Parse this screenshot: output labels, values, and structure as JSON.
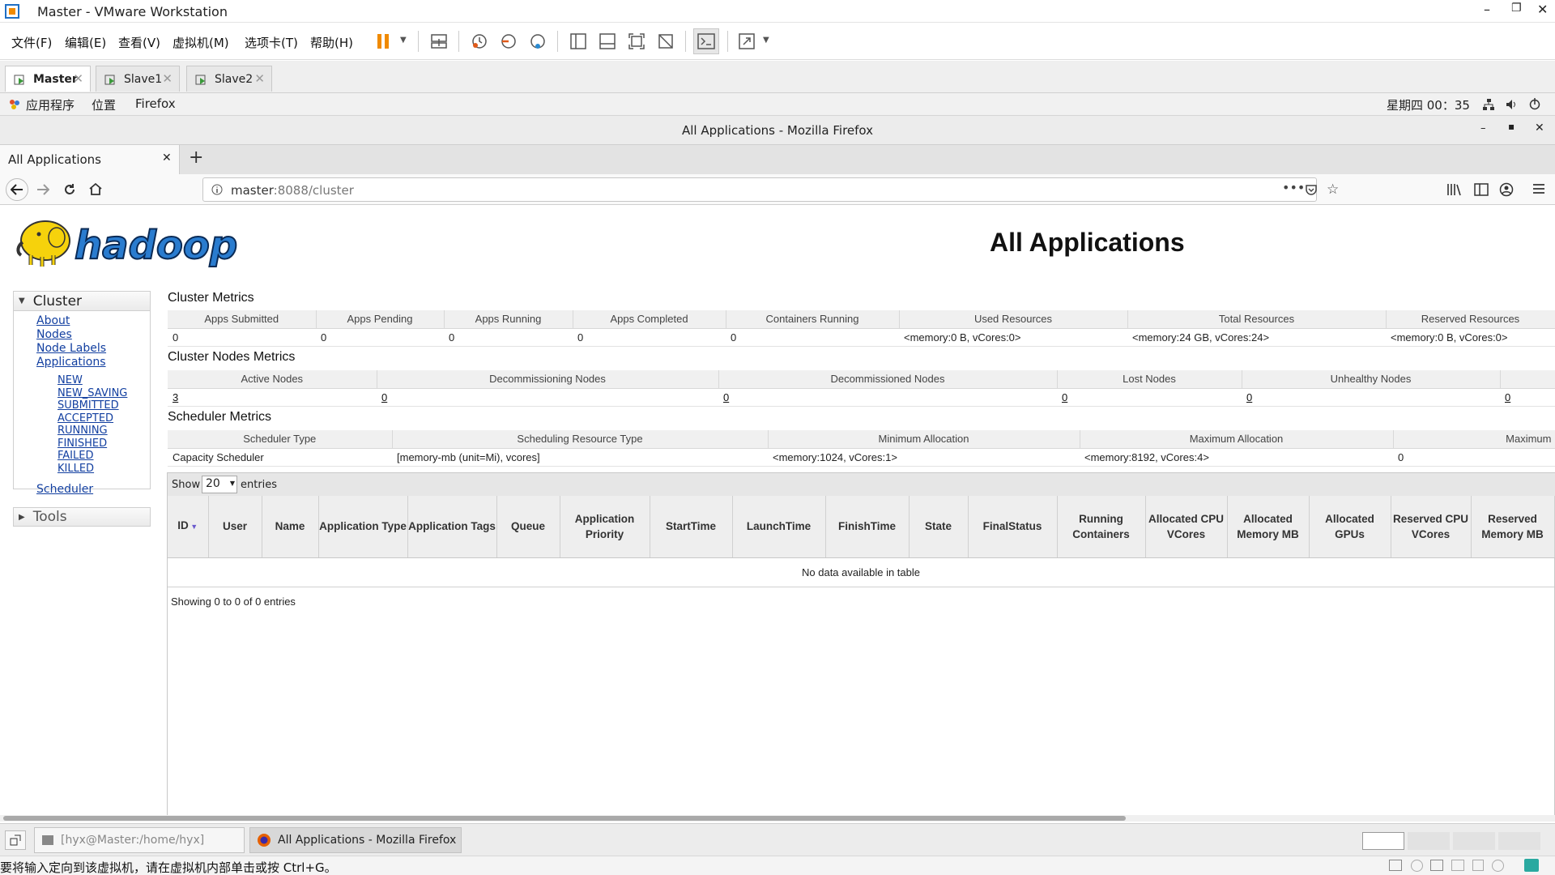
{
  "vmware": {
    "window_title": "Master - VMware Workstation",
    "menu": [
      "文件(F)",
      "编辑(E)",
      "查看(V)",
      "虚拟机(M)",
      "选项卡(T)",
      "帮助(H)"
    ],
    "tabs": [
      {
        "label": "Master",
        "active": true
      },
      {
        "label": "Slave1",
        "active": false
      },
      {
        "label": "Slave2",
        "active": false
      }
    ],
    "status_message": "要将输入定向到该虚拟机，请在虚拟机内部单击或按 Ctrl+G。"
  },
  "guest_panel": {
    "menus": [
      "应用程序",
      "位置",
      "Firefox"
    ],
    "clock": "星期四 00：35"
  },
  "firefox": {
    "window_title": "All Applications - Mozilla Firefox",
    "tab_label": "All Applications",
    "url_host": "master",
    "url_rest": ":8088/cluster"
  },
  "page": {
    "title": "All Applications",
    "nav": {
      "cluster_label": "Cluster",
      "links": [
        "About",
        "Nodes",
        "Node Labels",
        "Applications"
      ],
      "app_states": [
        "NEW",
        "NEW_SAVING",
        "SUBMITTED",
        "ACCEPTED",
        "RUNNING",
        "FINISHED",
        "FAILED",
        "KILLED"
      ],
      "scheduler_link": "Scheduler",
      "tools_label": "Tools"
    },
    "cluster_metrics": {
      "title": "Cluster Metrics",
      "headers": [
        "Apps Submitted",
        "Apps Pending",
        "Apps Running",
        "Apps Completed",
        "Containers Running",
        "Used Resources",
        "Total Resources",
        "Reserved Resources"
      ],
      "values": [
        "0",
        "0",
        "0",
        "0",
        "0",
        "<memory:0 B, vCores:0>",
        "<memory:24 GB, vCores:24>",
        "<memory:0 B, vCores:0>"
      ]
    },
    "cluster_nodes_metrics": {
      "title": "Cluster Nodes Metrics",
      "headers": [
        "Active Nodes",
        "Decommissioning Nodes",
        "Decommissioned Nodes",
        "Lost Nodes",
        "Unhealthy Nodes",
        ""
      ],
      "values": [
        "3",
        "0",
        "0",
        "0",
        "0",
        "0"
      ]
    },
    "scheduler_metrics": {
      "title": "Scheduler Metrics",
      "headers": [
        "Scheduler Type",
        "Scheduling Resource Type",
        "Minimum Allocation",
        "Maximum Allocation",
        "Maximum"
      ],
      "values": [
        "Capacity Scheduler",
        "[memory-mb (unit=Mi), vcores]",
        "<memory:1024, vCores:1>",
        "<memory:8192, vCores:4>",
        "0"
      ]
    },
    "apps_table": {
      "show_label": "Show",
      "entries_value": "20",
      "entries_label": "entries",
      "columns": [
        "ID",
        "User",
        "Name",
        "Application Type",
        "Application Tags",
        "Queue",
        "Application Priority",
        "StartTime",
        "LaunchTime",
        "FinishTime",
        "State",
        "FinalStatus",
        "Running Containers",
        "Allocated CPU VCores",
        "Allocated Memory MB",
        "Allocated GPUs",
        "Reserved CPU VCores",
        "Reserved Memory MB"
      ],
      "empty_message": "No data available in table",
      "info": "Showing 0 to 0 of 0 entries"
    }
  },
  "taskbar": {
    "items": [
      "[hyx@Master:/home/hyx]",
      "All Applications - Mozilla Firefox"
    ]
  },
  "colors": {
    "link": "#123fa0",
    "pause": "#f08a00",
    "hadoop_yellow": "#f6d20c",
    "hadoop_blue": "#2a7ccf"
  }
}
